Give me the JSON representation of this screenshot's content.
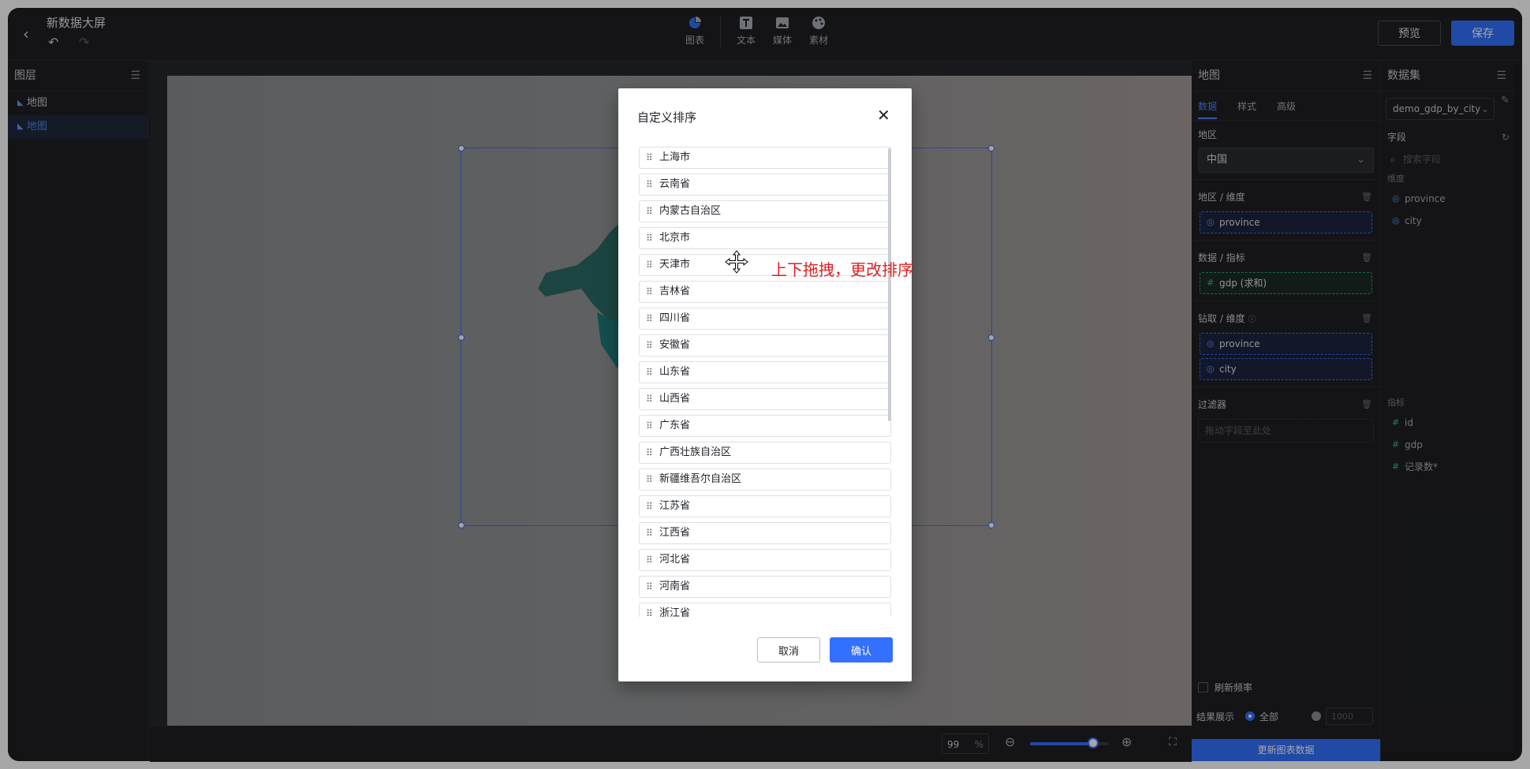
{
  "header": {
    "title": "新数据大屏",
    "tools": [
      "图表",
      "文本",
      "媒体",
      "素材"
    ],
    "preview_label": "预览",
    "save_label": "保存"
  },
  "layers": {
    "title": "图层",
    "items": [
      {
        "label": "地图",
        "selected": false
      },
      {
        "label": "地图",
        "selected": true
      }
    ]
  },
  "canvas": {
    "zoom": "99",
    "zoom_unit": "%",
    "zoom_slider_percent": 80
  },
  "chart_panel": {
    "title": "地图",
    "tabs": [
      "数据",
      "样式",
      "高级"
    ],
    "active_tab": "数据",
    "region_label": "地区",
    "region_value": "中国",
    "dimension_label": "地区 / 维度",
    "dimension_fields": [
      "province"
    ],
    "metric_label": "数据 / 指标",
    "metric_fields": [
      "gdp (求和)"
    ],
    "drill_label": "钻取 / 维度",
    "drill_fields": [
      "province",
      "city"
    ],
    "filter_label": "过滤器",
    "filter_placeholder": "拖动字段至此处",
    "refresh_label": "刷新频率",
    "result_label": "结果展示",
    "result_all": "全部",
    "result_count": "1000",
    "update_label": "更新图表数据"
  },
  "dataset_panel": {
    "title": "数据集",
    "dataset": "demo_gdp_by_city",
    "fields_label": "字段",
    "search_placeholder": "搜索字段",
    "dimension_label": "维度",
    "dimensions": [
      "province",
      "city"
    ],
    "metric_label": "指标",
    "metrics": [
      "id",
      "gdp",
      "记录数*"
    ]
  },
  "dialog": {
    "title": "自定义排序",
    "items": [
      "上海市",
      "云南省",
      "内蒙古自治区",
      "北京市",
      "天津市",
      "吉林省",
      "四川省",
      "安徽省",
      "山东省",
      "山西省",
      "广东省",
      "广西壮族自治区",
      "新疆维吾尔自治区",
      "江苏省",
      "江西省",
      "河北省",
      "河南省",
      "浙江省"
    ],
    "cancel_label": "取消",
    "ok_label": "确认"
  },
  "annotation": "上下拖拽，更改排序",
  "colors": {
    "accent": "#3370ff",
    "annotation": "#e02020"
  }
}
